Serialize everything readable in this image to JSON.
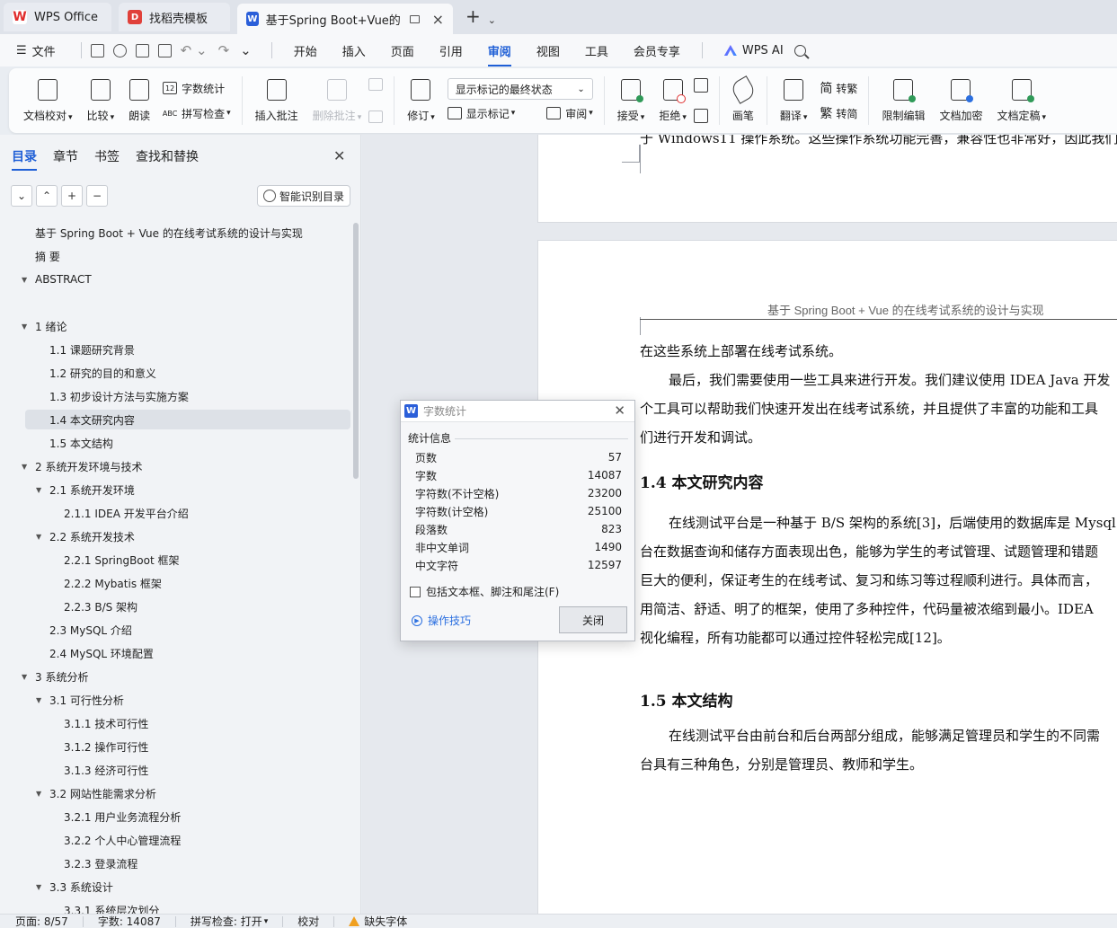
{
  "tabs": [
    {
      "label": "WPS Office",
      "icon": "wps-logo-icon"
    },
    {
      "label": "找稻壳模板",
      "icon": "docer-icon"
    },
    {
      "label": "基于Spring Boot+Vue的在线",
      "icon": "writer-icon",
      "active": true
    }
  ],
  "menubar": {
    "file": "文件",
    "items": [
      "开始",
      "插入",
      "页面",
      "引用",
      "审阅",
      "视图",
      "工具",
      "会员专享"
    ],
    "active": "审阅",
    "ai": "WPS AI"
  },
  "ribbon": {
    "doc_proof": "文档校对",
    "compare": "比较",
    "read_aloud": "朗读",
    "word_count": "字数统计",
    "spell_check": "拼写检查",
    "insert_comment": "插入批注",
    "delete_comment": "删除批注",
    "revise": "修订",
    "markup_state": "显示标记的最终状态",
    "show_markup": "显示标记",
    "review": "审阅",
    "accept": "接受",
    "reject": "拒绝",
    "pen": "画笔",
    "translate": "翻译",
    "to_traditional": "转繁",
    "to_simplified": "转简",
    "restrict_edit": "限制编辑",
    "encrypt": "文档加密",
    "finalize": "文档定稿"
  },
  "nav": {
    "tabs": [
      "目录",
      "章节",
      "书签",
      "查找和替换"
    ],
    "active_tab": "目录",
    "smart_toc": "智能识别目录",
    "toc": [
      {
        "text": "基于 Spring Boot + Vue 的在线考试系统的设计与实现",
        "level": 0,
        "tri": false
      },
      {
        "text": "摘    要",
        "level": 0,
        "tri": false
      },
      {
        "text": "ABSTRACT",
        "level": 0,
        "tri": true
      },
      {
        "text": "",
        "level": 0,
        "tri": false
      },
      {
        "text": "1 绪论",
        "level": 0,
        "tri": true
      },
      {
        "text": "1.1  课题研究背景",
        "level": 1,
        "tri": false
      },
      {
        "text": "1.2  研究的目的和意义",
        "level": 1,
        "tri": false
      },
      {
        "text": "1.3 初步设计方法与实施方案",
        "level": 1,
        "tri": false
      },
      {
        "text": "1.4 本文研究内容",
        "level": 1,
        "tri": false,
        "selected": true
      },
      {
        "text": "1.5 本文结构",
        "level": 1,
        "tri": false
      },
      {
        "text": "2 系统开发环境与技术",
        "level": 0,
        "tri": true
      },
      {
        "text": "2.1  系统开发环境",
        "level": 1,
        "tri": true
      },
      {
        "text": "2.1.1 IDEA  开发平台介绍",
        "level": 2,
        "tri": false
      },
      {
        "text": "2.2 系统开发技术",
        "level": 1,
        "tri": true
      },
      {
        "text": "2.2.1 SpringBoot 框架",
        "level": 2,
        "tri": false
      },
      {
        "text": "2.2.2 Mybatis 框架",
        "level": 2,
        "tri": false
      },
      {
        "text": "2.2.3 B/S 架构",
        "level": 2,
        "tri": false
      },
      {
        "text": "2.3 MySQL  介绍",
        "level": 1,
        "tri": false
      },
      {
        "text": "2.4 MySQL  环境配置",
        "level": 1,
        "tri": false
      },
      {
        "text": "3 系统分析",
        "level": 0,
        "tri": true
      },
      {
        "text": "3.1 可行性分析",
        "level": 1,
        "tri": true
      },
      {
        "text": "3.1.1 技术可行性",
        "level": 2,
        "tri": false
      },
      {
        "text": "3.1.2 操作可行性",
        "level": 2,
        "tri": false
      },
      {
        "text": "3.1.3 经济可行性",
        "level": 2,
        "tri": false
      },
      {
        "text": "3.2  网站性能需求分析",
        "level": 1,
        "tri": true
      },
      {
        "text": "3.2.1  用户业务流程分析",
        "level": 2,
        "tri": false
      },
      {
        "text": "3.2.2 个人中心管理流程",
        "level": 2,
        "tri": false
      },
      {
        "text": "3.2.3  登录流程",
        "level": 2,
        "tri": false
      },
      {
        "text": "3.3 系统设计",
        "level": 1,
        "tri": true
      },
      {
        "text": "3.3.1 系统层次划分",
        "level": 2,
        "tri": false
      }
    ]
  },
  "doc": {
    "page1_line": "于 Windows11 操作系统。这些操作系统功能完善，兼容性也非常好，因此我们",
    "header": "基于 Spring Boot + Vue 的在线考试系统的设计与实现",
    "lines": [
      "在这些系统上部署在线考试系统。",
      "最后，我们需要使用一些工具来进行开发。我们建议使用 IDEA Java 开发",
      "个工具可以帮助我们快速开发出在线考试系统，并且提供了丰富的功能和工具",
      "们进行开发和调试。"
    ],
    "h14": "1.4 本文研究内容",
    "p14": [
      "在线测试平台是一种基于 B/S 架构的系统[3]，后端使用的数据库是 Mysql",
      "台在数据查询和储存方面表现出色，能够为学生的考试管理、试题管理和错题",
      "巨大的便利，保证考生的在线考试、复习和练习等过程顺利进行。具体而言，",
      "用简洁、舒适、明了的框架，使用了多种控件，代码量被浓缩到最小。IDEA",
      "视化编程，所有功能都可以通过控件轻松完成[12]。"
    ],
    "h15": "1.5 本文结构",
    "p15": [
      "在线测试平台由前台和后台两部分组成，能够满足管理员和学生的不同需",
      "台具有三种角色，分别是管理员、教师和学生。"
    ]
  },
  "dialog": {
    "title": "字数统计",
    "section": "统计信息",
    "rows": [
      {
        "label": "页数",
        "value": "57"
      },
      {
        "label": "字数",
        "value": "14087"
      },
      {
        "label": "字符数(不计空格)",
        "value": "23200"
      },
      {
        "label": "字符数(计空格)",
        "value": "25100"
      },
      {
        "label": "段落数",
        "value": "823"
      },
      {
        "label": "非中文单词",
        "value": "1490"
      },
      {
        "label": "中文字符",
        "value": "12597"
      }
    ],
    "checkbox": "包括文本框、脚注和尾注(F)",
    "tips": "操作技巧",
    "close": "关闭"
  },
  "status": {
    "page": "页面: 8/57",
    "words": "字数: 14087",
    "spell": "拼写检查: 打开",
    "proof": "校对",
    "missing_font": "缺失字体"
  },
  "colors": {
    "accent": "#1f5fd6",
    "writer": "#2b5fd9",
    "warning": "#f0a020"
  }
}
